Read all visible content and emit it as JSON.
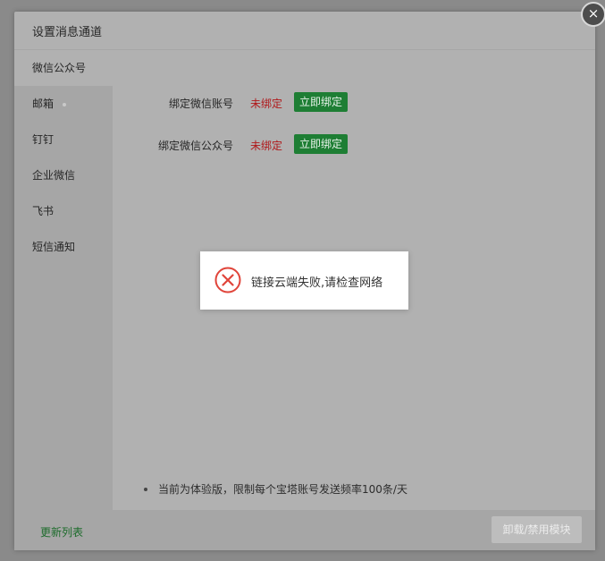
{
  "dialog": {
    "title": "设置消息通道",
    "close_icon": "×"
  },
  "sidebar": {
    "items": [
      {
        "label": "微信公众号",
        "active": true
      },
      {
        "label": "邮箱",
        "dot": true
      },
      {
        "label": "钉钉"
      },
      {
        "label": "企业微信"
      },
      {
        "label": "飞书"
      },
      {
        "label": "短信通知"
      }
    ]
  },
  "bindings": [
    {
      "label": "绑定微信账号",
      "status": "未绑定",
      "button": "立即绑定"
    },
    {
      "label": "绑定微信公众号",
      "status": "未绑定",
      "button": "立即绑定"
    }
  ],
  "note": "当前为体验版，限制每个宝塔账号发送频率100条/天",
  "footer": {
    "update_link": "更新列表",
    "disable_button": "卸载/禁用模块"
  },
  "toast": {
    "message": "链接云端失败,请检查网络",
    "icon": "error-x-icon",
    "icon_color": "#e0443a"
  },
  "colors": {
    "accent": "#1e7e34",
    "unbound": "#b0181a"
  }
}
